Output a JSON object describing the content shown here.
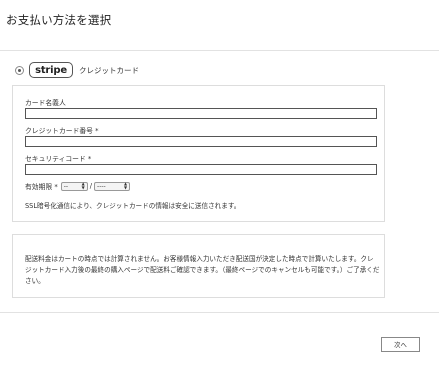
{
  "page": {
    "title": "お支払い方法を選択"
  },
  "payment_method": {
    "selected": true,
    "brand": "stripe",
    "label": "クレジットカード"
  },
  "card_form": {
    "name_label": "カード名義人",
    "number_label": "クレジットカード番号 *",
    "security_label": "セキュリティコード *",
    "expiry_label": "有効期限 *",
    "expiry_month_value": "--",
    "expiry_separator": "/",
    "expiry_year_value": "----",
    "ssl_note": "SSL暗号化通信により、クレジットカードの情報は安全に送信されます。"
  },
  "shipping_note": "配送料金はカートの時点では計算されません。お客様情報入力いただき配送国が決定した時点で計算いたします。クレジットカード入力後の最終の購入ページで配送料ご確認できます。（最終ページでのキャンセルも可能です。）ご了承ください。",
  "footer": {
    "next_label": "次へ"
  }
}
